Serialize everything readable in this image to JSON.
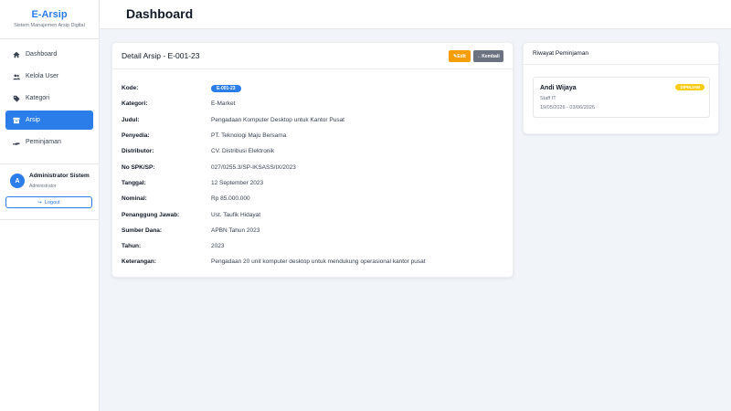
{
  "brand": {
    "title": "E-Arsip",
    "subtitle": "Sistem Manajemen Arsip Digital"
  },
  "sidebar": {
    "items": [
      {
        "label": "Dashboard",
        "icon": "home-icon"
      },
      {
        "label": "Kelola User",
        "icon": "users-icon"
      },
      {
        "label": "Kategori",
        "icon": "tag-icon"
      },
      {
        "label": "Arsip",
        "icon": "archive-icon",
        "active": true
      },
      {
        "label": "Peminjaman",
        "icon": "hand-icon"
      }
    ],
    "user": {
      "initial": "A",
      "name": "Administrator Sistem",
      "role": "Administrator"
    },
    "logout_label": "Logout"
  },
  "header": {
    "title": "Dashboard"
  },
  "detail": {
    "title": "Detail Arsip - E-001-23",
    "edit_label": "Edit",
    "back_label": "Kembali",
    "rows": [
      {
        "label": "Kode:",
        "value": "E-001-23"
      },
      {
        "label": "Kategori:",
        "value": "E-Market"
      },
      {
        "label": "Judul:",
        "value": "Pengadaan Komputer Desktop untuk Kantor Pusat"
      },
      {
        "label": "Penyedia:",
        "value": "PT. Teknologi Maju Bersama"
      },
      {
        "label": "Distributor:",
        "value": "CV. Distribusi Elektronik"
      },
      {
        "label": "No SPK/SP:",
        "value": "027/0255.3/SP-IKSASS/IX/2023"
      },
      {
        "label": "Tanggal:",
        "value": "12 September 2023"
      },
      {
        "label": "Nominal:",
        "value": "Rp 85.000.000"
      },
      {
        "label": "Penanggung Jawab:",
        "value": "Ust. Taufik Hidayat"
      },
      {
        "label": "Sumber Dana:",
        "value": "APBN Tahun 2023"
      },
      {
        "label": "Tahun:",
        "value": "2023"
      },
      {
        "label": "Keterangan:",
        "value": "Pengadaan 20 unit komputer desktop untuk mendukung operasional kantor pusat"
      }
    ]
  },
  "history": {
    "title": "Riwayat Peminjaman",
    "items": [
      {
        "name": "Andi Wijaya",
        "role": "Staff IT",
        "date_range": "19/05/2026 - 03/06/2026",
        "status": "DIPINJAM"
      }
    ]
  },
  "colors": {
    "primary": "#2b7de9",
    "edit": "#f59e0b",
    "back": "#6b7280",
    "status_borrowed": "#facc15"
  }
}
